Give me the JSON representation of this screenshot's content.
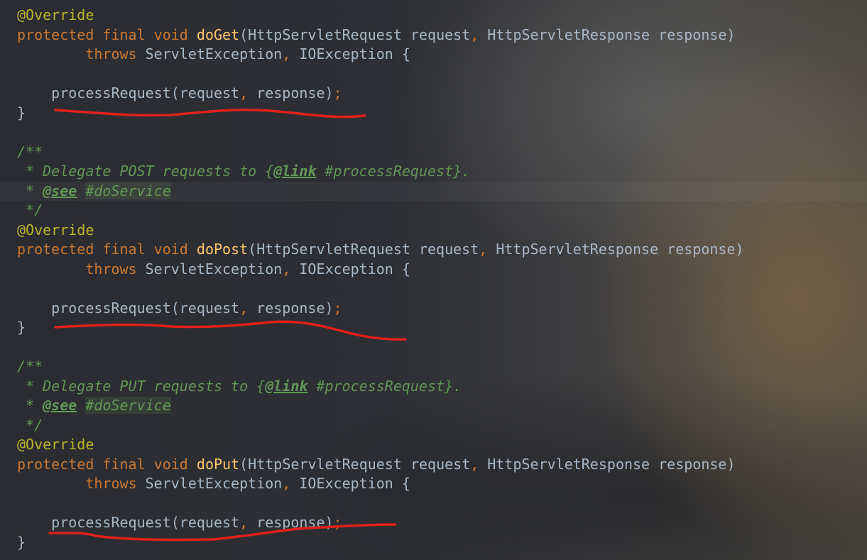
{
  "code": {
    "annotation": "@Override",
    "kw_protected": "protected",
    "kw_final": "final",
    "kw_void": "void",
    "kw_throws": "throws",
    "m_doGet": "doGet",
    "m_doPost": "doPost",
    "m_doPut": "doPut",
    "params_open": "(HttpServletRequest request",
    "comma": ",",
    "params_close": " HttpServletResponse response)",
    "exceptions": " ServletException",
    "ioexception": " IOException {",
    "call": "processRequest(request",
    "call_end": " response)",
    "semicolon": ";",
    "brace_close": "}",
    "doc_open": "/**",
    "doc_star": " * ",
    "doc_post_text": "Delegate POST requests to {",
    "doc_put_text": "Delegate PUT requests to {",
    "doc_link_tag": "@link",
    "doc_link_ref": " #processRequest}.",
    "doc_see_tag": "@see",
    "doc_see_ref": "#doService",
    "doc_close": " */"
  },
  "annotations": {
    "underline_color": "#e0201a"
  }
}
